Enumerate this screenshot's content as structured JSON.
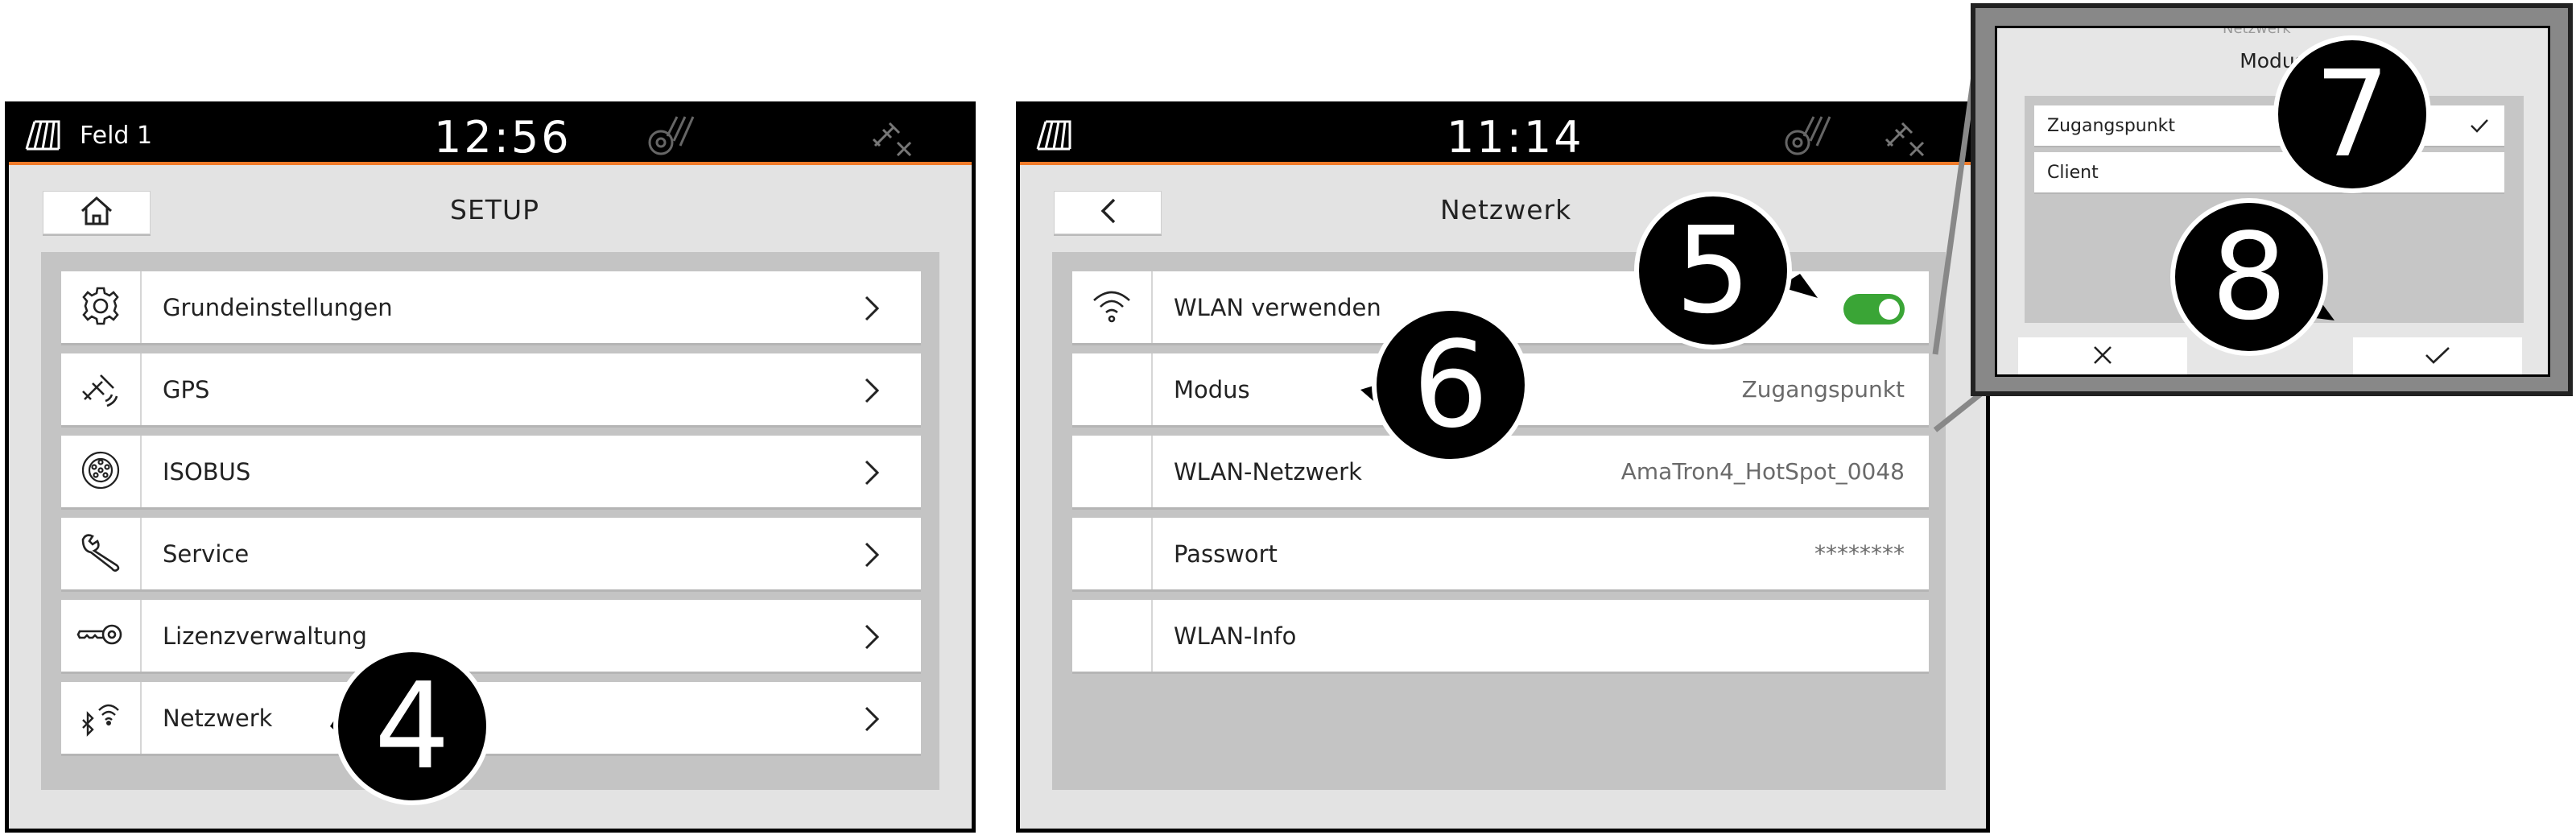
{
  "screen1": {
    "status": {
      "field": "Feld 1",
      "time": "12:56"
    },
    "header": {
      "title": "SETUP",
      "home_icon": "home-icon"
    },
    "items": [
      {
        "label": "Grundeinstellungen",
        "icon": "gear-icon"
      },
      {
        "label": "GPS",
        "icon": "satellite-icon"
      },
      {
        "label": "ISOBUS",
        "icon": "isobus-connector-icon"
      },
      {
        "label": "Service",
        "icon": "wrench-icon"
      },
      {
        "label": "Lizenzverwaltung",
        "icon": "key-icon"
      },
      {
        "label": "Netzwerk",
        "icon": "network-bluetooth-wifi-icon"
      }
    ]
  },
  "screen2": {
    "status": {
      "time": "11:14"
    },
    "header": {
      "title": "Netzwerk",
      "back_icon": "chevron-left-icon"
    },
    "rows": [
      {
        "label": "WLAN verwenden",
        "value": "",
        "icon": "wifi-icon",
        "toggle_on": true
      },
      {
        "label": "Modus",
        "value": "Zugangspunkt"
      },
      {
        "label": "WLAN-Netzwerk",
        "value": "AmaTron4_HotSpot_0048"
      },
      {
        "label": "Passwort",
        "value": "********"
      },
      {
        "label": "WLAN-Info",
        "value": ""
      }
    ]
  },
  "zoom": {
    "title": "Modus",
    "options": [
      {
        "label": "Zugangspunkt",
        "selected": true
      },
      {
        "label": "Client",
        "selected": false
      }
    ],
    "cancel_icon": "x-icon",
    "confirm_icon": "checkmark-icon",
    "background_text": "Netzwerk"
  },
  "callouts": [
    "4",
    "5",
    "6",
    "7",
    "8"
  ],
  "colors": {
    "accent_orange": "#f07b2a",
    "toggle_green": "#3aa536",
    "cancel_red": "#d23a3a",
    "confirm_green": "#3aa536"
  }
}
